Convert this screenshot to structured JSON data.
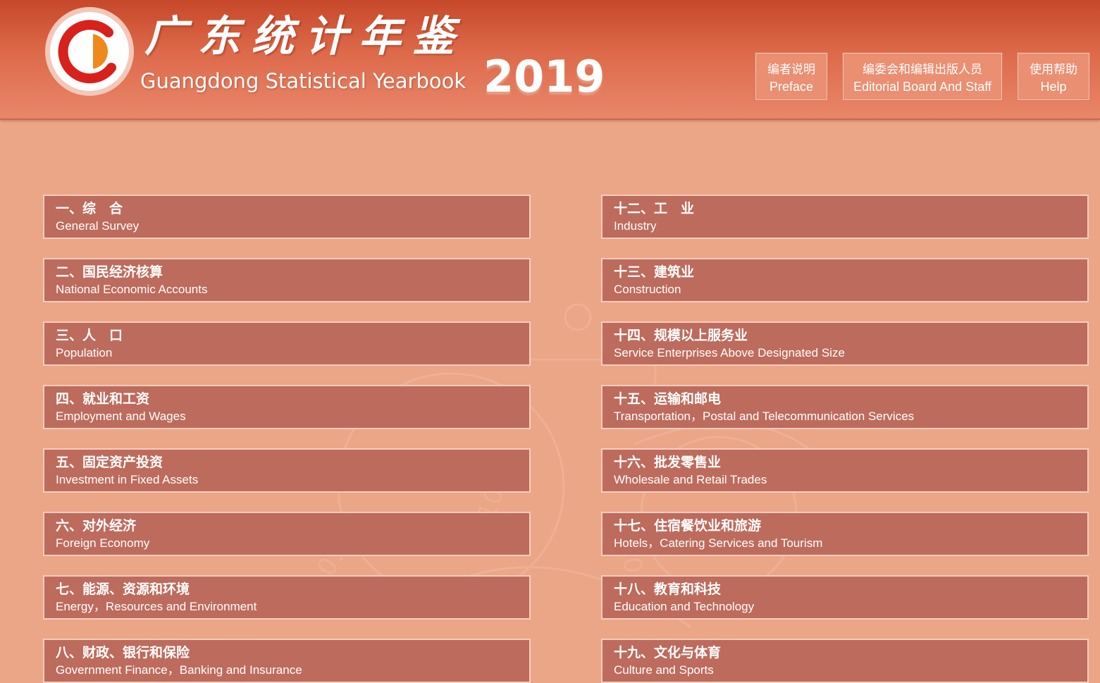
{
  "header": {
    "title_cn": "广东统计年鉴",
    "title_en": "Guangdong Statistical Yearbook",
    "year": "2019",
    "buttons": [
      {
        "cn": "编者说明",
        "en": "Preface"
      },
      {
        "cn": "编委会和编辑出版人员",
        "en": "Editorial Board And Staff"
      },
      {
        "cn": "使用帮助",
        "en": "Help"
      }
    ]
  },
  "chapters_left": [
    {
      "cn": "一、综　合",
      "en": "General Survey"
    },
    {
      "cn": "二、国民经济核算",
      "en": "National Economic Accounts"
    },
    {
      "cn": "三、人　口",
      "en": "Population"
    },
    {
      "cn": "四、就业和工资",
      "en": "Employment and Wages"
    },
    {
      "cn": "五、固定资产投资",
      "en": "Investment in Fixed Assets"
    },
    {
      "cn": "六、对外经济",
      "en": "Foreign Economy"
    },
    {
      "cn": "七、能源、资源和环境",
      "en": "Energy，Resources and Environment"
    },
    {
      "cn": "八、财政、银行和保险",
      "en": "Government Finance，Banking and Insurance"
    }
  ],
  "chapters_right": [
    {
      "cn": "十二、工　业",
      "en": "Industry"
    },
    {
      "cn": "十三、建筑业",
      "en": "Construction"
    },
    {
      "cn": "十四、规模以上服务业",
      "en": "Service Enterprises Above Designated Size"
    },
    {
      "cn": "十五、运输和邮电",
      "en": "Transportation，Postal and Telecommunication Services"
    },
    {
      "cn": "十六、批发零售业",
      "en": "Wholesale and Retail Trades"
    },
    {
      "cn": "十七、住宿餐饮业和旅游",
      "en": "Hotels，Catering Services and Tourism"
    },
    {
      "cn": "十八、教育和科技",
      "en": "Education and Technology"
    },
    {
      "cn": "十九、文化与体育",
      "en": "Culture and Sports"
    }
  ],
  "colors": {
    "header_top": "#c7482a",
    "page_bg": "#eba587",
    "item_bg": "#bd6b5d",
    "item_border": "#f7cdbd"
  }
}
